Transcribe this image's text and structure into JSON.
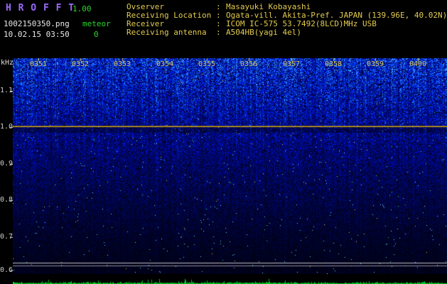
{
  "app": {
    "title": "H R O F F T",
    "version": "1.00",
    "filename": "1002150350.png",
    "mode": "meteor",
    "meteor_count": "0",
    "timestamp": "10.02.15 03:50"
  },
  "observer_info": {
    "separator": ":",
    "rows": [
      {
        "label": "Ovserver",
        "value": "Masayuki Kobayashi"
      },
      {
        "label": "Receiving Location",
        "value": "Ogata-vill. Akita-Pref. JAPAN (139.96E, 40.02N)"
      },
      {
        "label": "Receiver",
        "value": "ICOM IC-575 53.7492(8LCD)MHz USB"
      },
      {
        "label": "Receiving antenna",
        "value": "A504HB(yagi 4el)"
      }
    ]
  },
  "chart_data": {
    "type": "heatmap",
    "description": "10-minute radio spectrogram of band noise (blue, brighter toward higher frequency) with a steady carrier line near 1.0 kHz and two thin marker lines near 0.62 kHz; green signal-level trace strip along the bottom",
    "ylabel": "kHz",
    "time_labels": [
      "0351",
      "0352",
      "0353",
      "0354",
      "0355",
      "0356",
      "0357",
      "0358",
      "0359",
      "0400"
    ],
    "freq_labels": [
      "1.1",
      "1.0",
      "0.9",
      "0.8",
      "0.7",
      "0.6"
    ],
    "x_range_time": [
      "03:50",
      "04:00"
    ],
    "y_range_khz": [
      0.6,
      1.15
    ],
    "carrier_line_khz": 1.02,
    "grid": false,
    "legend": false
  },
  "palette": {
    "background": "#000000",
    "title_color": "#9b6bff",
    "version_color": "#2ed52e",
    "header_text": "#e3cb4e",
    "file_text": "#e8e8e8",
    "axis_text": "#cccccc",
    "time_label": "#d6c355",
    "carrier_line": "#e0b000",
    "marker_line": "#d9d9d9",
    "meter_green": "#00d028"
  }
}
